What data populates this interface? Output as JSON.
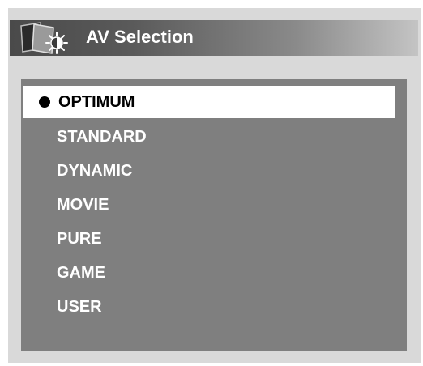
{
  "header": {
    "title": "AV Selection",
    "icon": "av-picture-brightness-icon"
  },
  "menu": {
    "selected_index": 0,
    "items": [
      {
        "label": "OPTIMUM",
        "selected": true
      },
      {
        "label": "STANDARD",
        "selected": false
      },
      {
        "label": "DYNAMIC",
        "selected": false
      },
      {
        "label": "MOVIE",
        "selected": false
      },
      {
        "label": "PURE",
        "selected": false
      },
      {
        "label": "GAME",
        "selected": false
      },
      {
        "label": "USER",
        "selected": false
      }
    ]
  },
  "colors": {
    "frame": "#d9d9d9",
    "panel": "#7f7f7f",
    "highlight": "#ffffff",
    "title_text": "#ffffff",
    "item_text": "#ffffff",
    "selected_text": "#000000"
  }
}
